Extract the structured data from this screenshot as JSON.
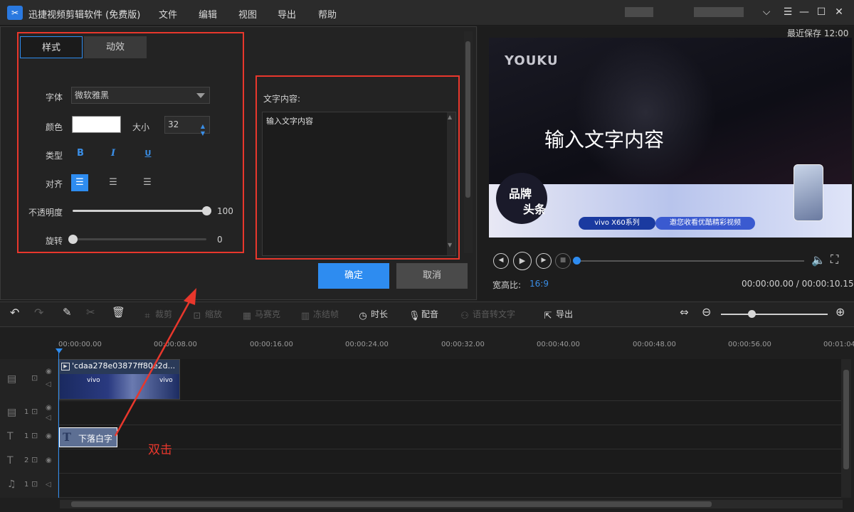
{
  "app": {
    "title": "迅捷视频剪辑软件 (免费版)",
    "menus": [
      "文件",
      "编辑",
      "视图",
      "导出",
      "帮助"
    ]
  },
  "style_panel": {
    "tabs": [
      "样式",
      "动效"
    ],
    "font_label": "字体",
    "font_value": "微软雅黑",
    "color_label": "颜色",
    "color_value": "#ffffff",
    "size_label": "大小",
    "size_value": "32",
    "type_label": "类型",
    "type_buttons": [
      "B",
      "I",
      "U"
    ],
    "align_label": "对齐",
    "opacity_label": "不透明度",
    "opacity_value": "100",
    "rotate_label": "旋转",
    "rotate_value": "0"
  },
  "text_panel": {
    "label": "文字内容:",
    "content": "输入文字内容",
    "ok": "确定",
    "cancel": "取消"
  },
  "preview": {
    "last_saved": "最近保存 12:00",
    "overlay_text": "输入文字内容",
    "watermark": "YOUKU",
    "brand_badge": [
      "品牌",
      "头条"
    ],
    "banner_left": "vivo X60系列",
    "banner_right": "邀您收看优酷精彩视频",
    "aspect_label": "宽高比:",
    "aspect_value": "16:9",
    "time": "00:00:00.00 / 00:00:10.15",
    "progress": 0
  },
  "toolbar": {
    "tools": [
      "裁剪",
      "缩放",
      "马赛克",
      "冻结帧",
      "时长",
      "配音",
      "语音转文字",
      "导出"
    ]
  },
  "timeline": {
    "ticks": [
      "00:00:00.00",
      "00:00:08.00",
      "00:00:16.00",
      "00:00:24.00",
      "00:00:32.00",
      "00:00:40.00",
      "00:00:48.00",
      "00:00:56.00",
      "00:01:04"
    ],
    "video_clip_name": "'cdaa278e03877ff80e2d...",
    "clip_thumb_text": "vivo",
    "text_clip": "下落白字",
    "track_nums": [
      "1",
      "1",
      "2",
      "1"
    ],
    "annotation": "双击"
  },
  "colors": {
    "accent": "#2e8cf0",
    "highlight": "#e8372c"
  }
}
